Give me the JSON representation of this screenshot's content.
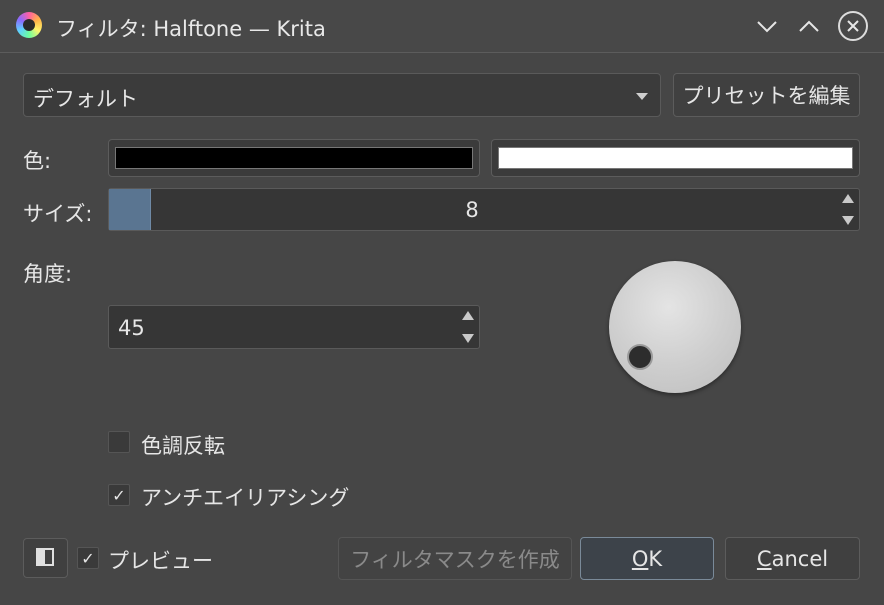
{
  "window": {
    "title": "フィルタ: Halftone — Krita",
    "icon": "krita-app-icon",
    "controls": [
      "minimize-icon",
      "maximize-icon",
      "close-icon"
    ]
  },
  "preset": {
    "selected": "デフォルト",
    "edit_button": "プリセットを編集"
  },
  "color": {
    "label": "色:",
    "foreground": "#000000",
    "background": "#ffffff"
  },
  "size": {
    "label": "サイズ:",
    "value": "8",
    "fill_fraction": 0.055
  },
  "angle": {
    "label": "角度:",
    "value": "45"
  },
  "options": {
    "invert_label": "色調反転",
    "invert_checked": false,
    "antialias_label": "アンチエイリアシング",
    "antialias_checked": true
  },
  "footer": {
    "preview_label": "プレビュー",
    "preview_checked": true,
    "check_glyph": "✓",
    "create_mask_button": "フィルタマスクを作成",
    "ok_button": "OK",
    "ok_underline": "O",
    "ok_rest": "K",
    "cancel_button": "Cancel",
    "cancel_underline": "C",
    "cancel_rest": "ancel"
  },
  "colors": {
    "window_bg": "#464646",
    "accent_fill": "#5a7591"
  }
}
